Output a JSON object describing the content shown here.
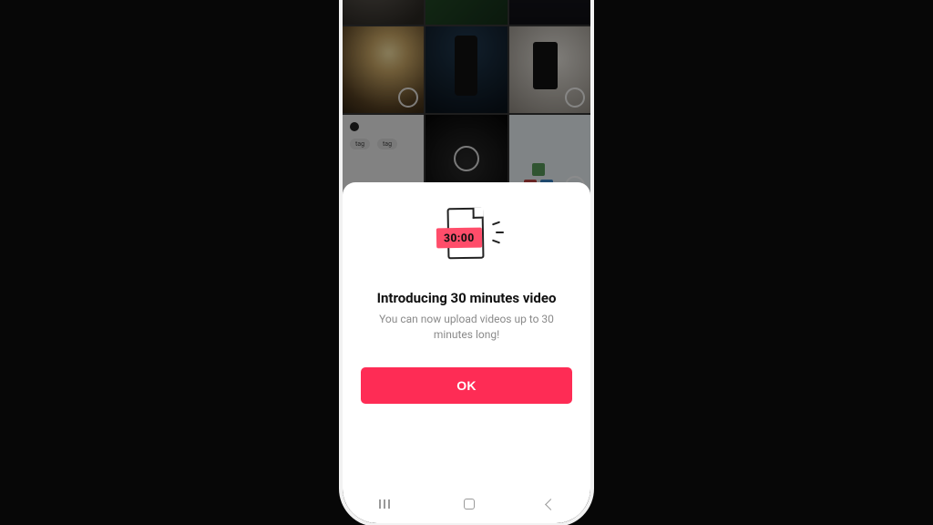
{
  "modal": {
    "badge_time": "30:00",
    "title": "Introducing 30 minutes video",
    "subtitle": "You can now upload videos up to 30 minutes long!",
    "ok_label": "OK"
  },
  "colors": {
    "accent": "#fe2c55",
    "badge": "#ff4d6a",
    "page_bg": "#070707"
  }
}
